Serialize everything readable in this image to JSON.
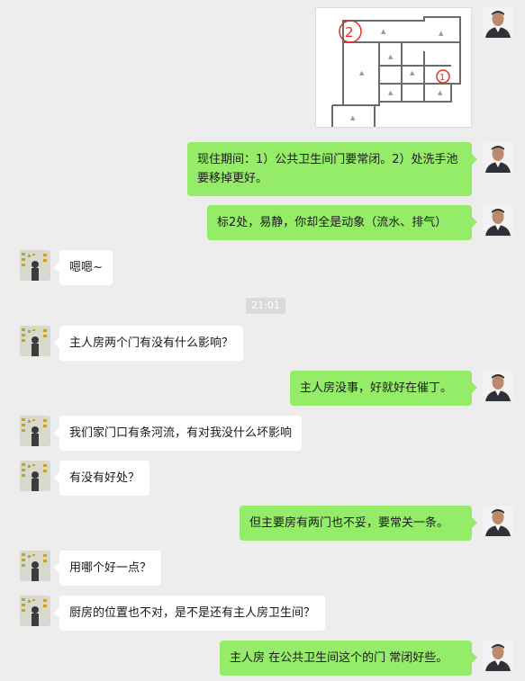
{
  "messages": [
    {
      "sender": "self",
      "type": "image",
      "image_alt": "floor plan with red markers",
      "markers": [
        "2",
        "1"
      ]
    },
    {
      "sender": "self",
      "text": "现住期间：1）公共卫生间门要常闭。2）处洗手池要移掉更好。"
    },
    {
      "sender": "self",
      "text": "标2处，易静，你却全是动象（流水、排气）"
    },
    {
      "sender": "other",
      "text": "嗯嗯~"
    },
    {
      "sender": "other",
      "text": "主人房两个门有没有什么影响？"
    },
    {
      "sender": "self",
      "text": "主人房没事，好就好在催丁。"
    },
    {
      "sender": "other",
      "text": "我们家门口有条河流，有对我没什么坏影响"
    },
    {
      "sender": "other",
      "text": "有没有好处？"
    },
    {
      "sender": "self",
      "text": "但主要房有两门也不妥，要常关一条。"
    },
    {
      "sender": "other",
      "text": "用哪个好一点？"
    },
    {
      "sender": "other",
      "text": "厨房的位置也不对，是不是还有主人房卫生间？"
    },
    {
      "sender": "self",
      "text": "主人房 在公共卫生间这个的门 常闭好些。"
    }
  ],
  "timestamp": "21:01",
  "colors": {
    "self_bubble": "#95ec69",
    "other_bubble": "#ffffff",
    "background": "#ededed",
    "marker": "#e0302a"
  },
  "icons": {
    "self_avatar": "man-portrait-icon",
    "other_avatar": "person-with-wall-icon"
  }
}
